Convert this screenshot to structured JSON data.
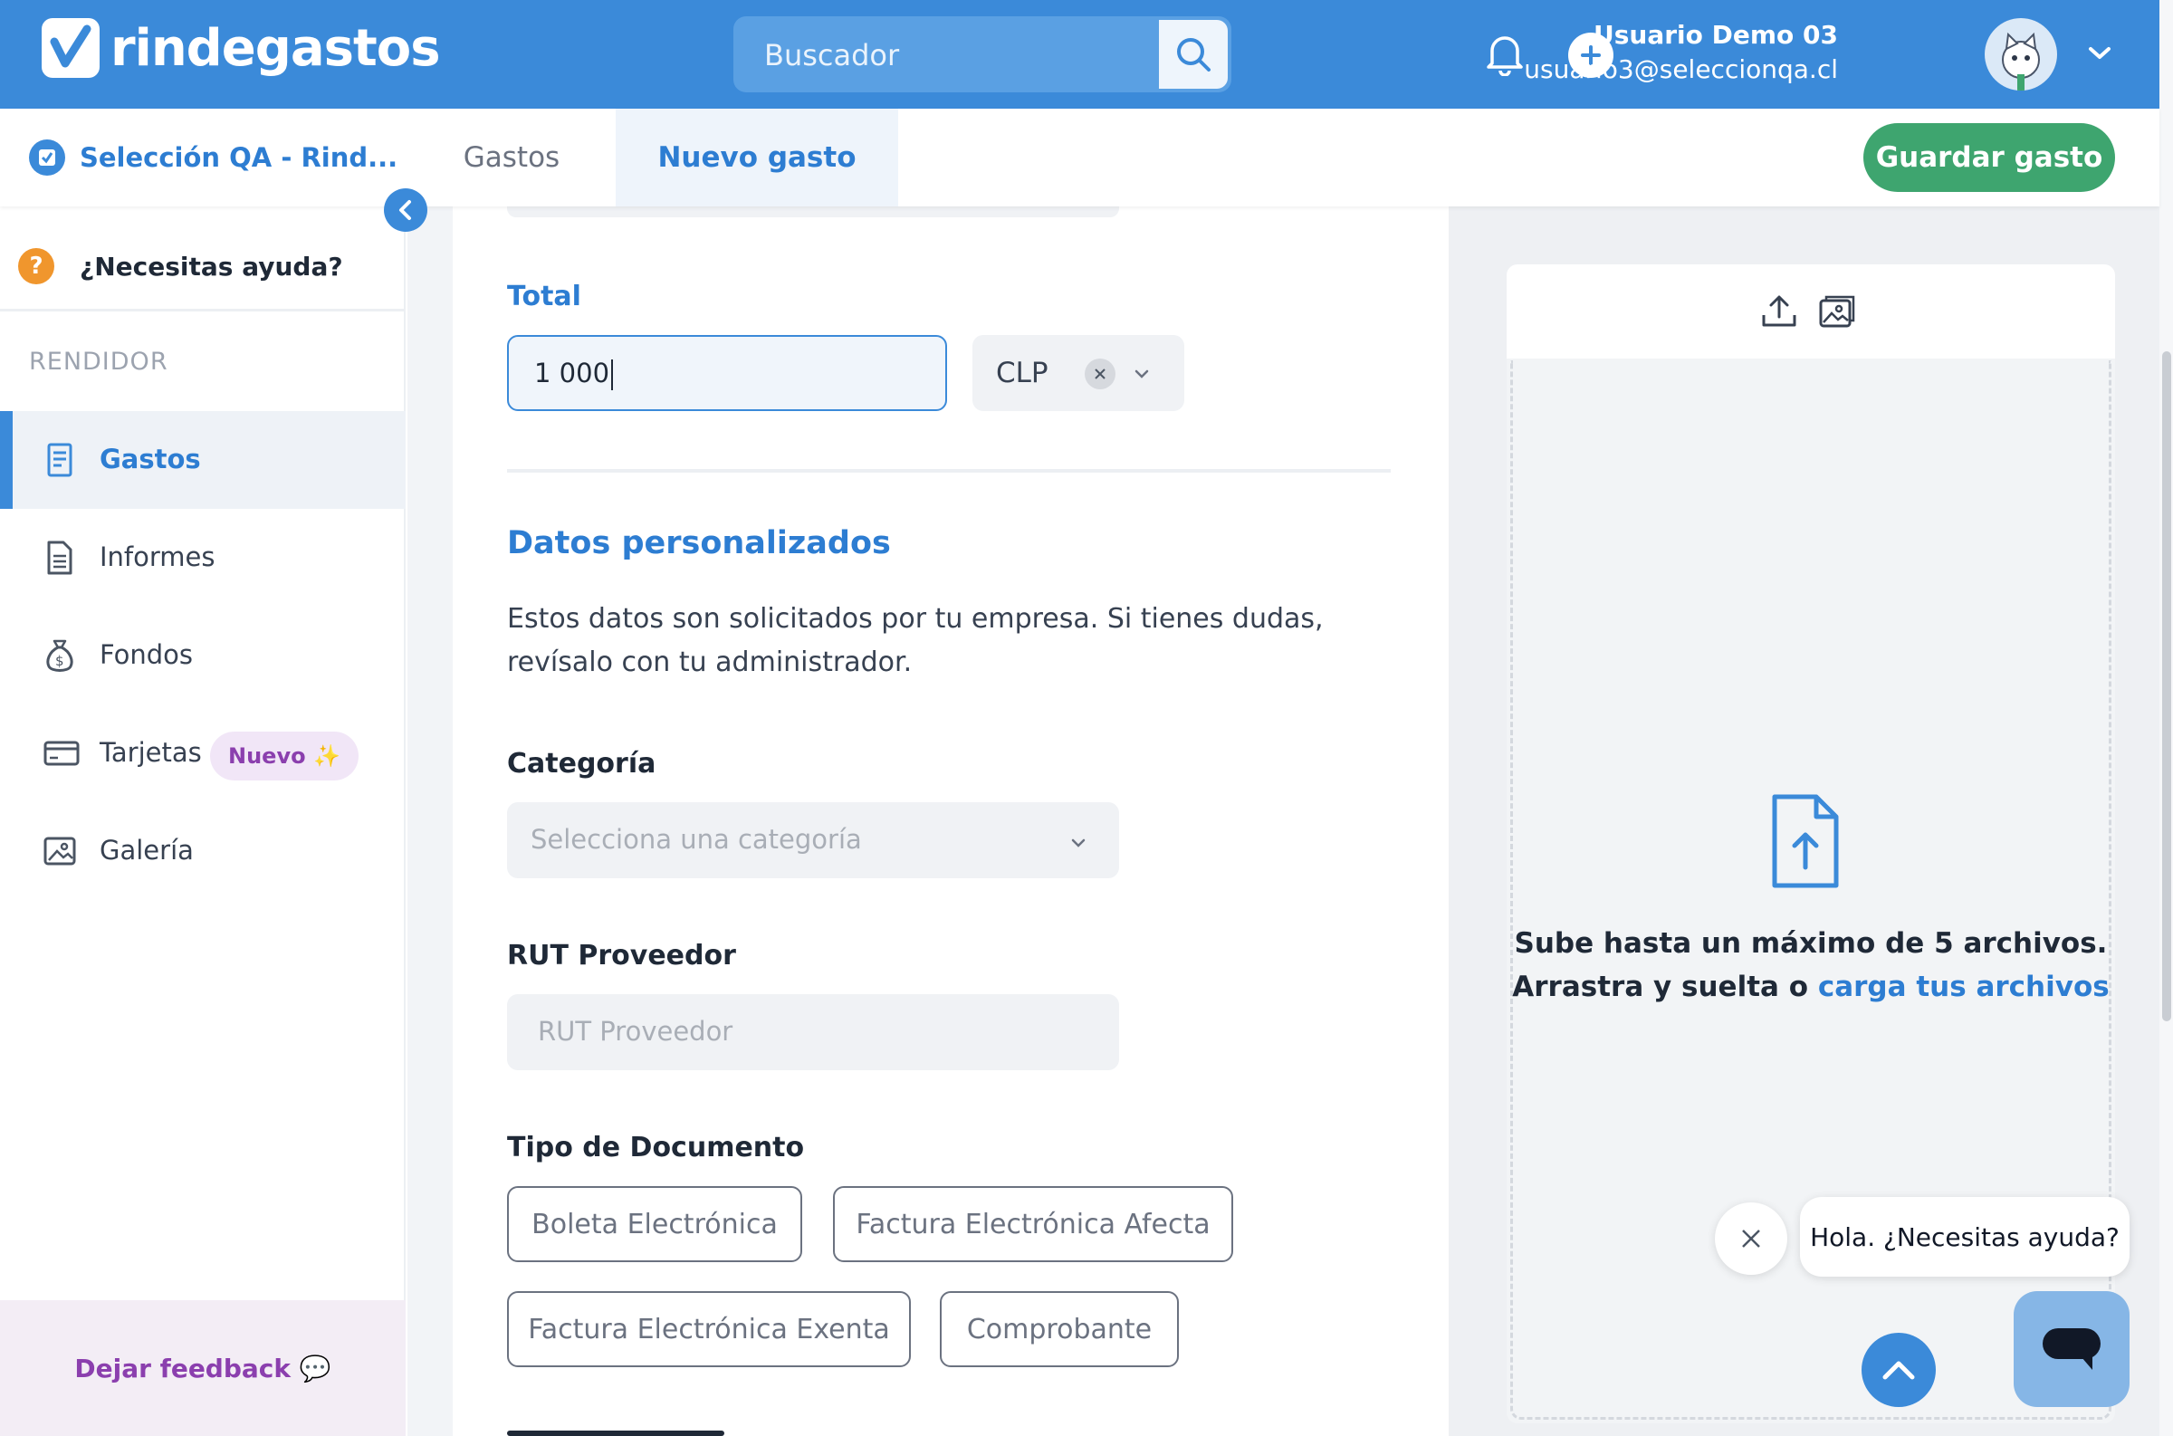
{
  "header": {
    "logo_text": "rindegastos",
    "search_placeholder": "Buscador",
    "user_name": "Usuario Demo 03",
    "user_email": "usuario3@seleccionqa.cl",
    "icons": [
      "bell-icon",
      "plus-circle-icon",
      "search-icon",
      "chevron-down-icon"
    ]
  },
  "subnav": {
    "company_name": "Selección QA - Rind...",
    "tabs": [
      {
        "label": "Gastos",
        "active": false
      },
      {
        "label": "Nuevo gasto",
        "active": true
      }
    ],
    "save_label": "Guardar gasto"
  },
  "sidebar": {
    "help_label": "¿Necesitas ayuda?",
    "section_label": "RENDIDOR",
    "items": [
      {
        "label": "Gastos",
        "icon": "receipt-icon",
        "active": true
      },
      {
        "label": "Informes",
        "icon": "document-icon",
        "active": false
      },
      {
        "label": "Fondos",
        "icon": "money-bag-icon",
        "active": false
      },
      {
        "label": "Tarjetas",
        "icon": "credit-card-icon",
        "active": false,
        "badge": "Nuevo ✨"
      },
      {
        "label": "Galería",
        "icon": "gallery-icon",
        "active": false
      }
    ],
    "feedback_label": "Dejar feedback 💬"
  },
  "form": {
    "total_label": "Total",
    "total_value": "1 000",
    "currency_value": "CLP",
    "section_title": "Datos personalizados",
    "section_desc": "Estos datos son solicitados por tu empresa. Si tienes dudas, revísalo con tu administrador.",
    "category_label": "Categoría",
    "category_placeholder": "Selecciona una categoría",
    "rut_label": "RUT Proveedor",
    "rut_placeholder": "RUT Proveedor",
    "doc_type_label": "Tipo de Documento",
    "doc_types": [
      "Boleta Electrónica",
      "Factura Electrónica Afecta",
      "Factura Electrónica Exenta",
      "Comprobante"
    ]
  },
  "upload": {
    "line1": "Sube hasta un máximo de 5 archivos.",
    "line2_prefix": "Arrastra y suelta o ",
    "line2_link": "carga tus archivos"
  },
  "chat": {
    "bubble_text": "Hola. ¿Necesitas ayuda?"
  },
  "colors": {
    "primary": "#3b8ad9",
    "accent_text": "#2d7dd2",
    "save_green": "#3ea56f",
    "badge_purple": "#8b3fae"
  }
}
